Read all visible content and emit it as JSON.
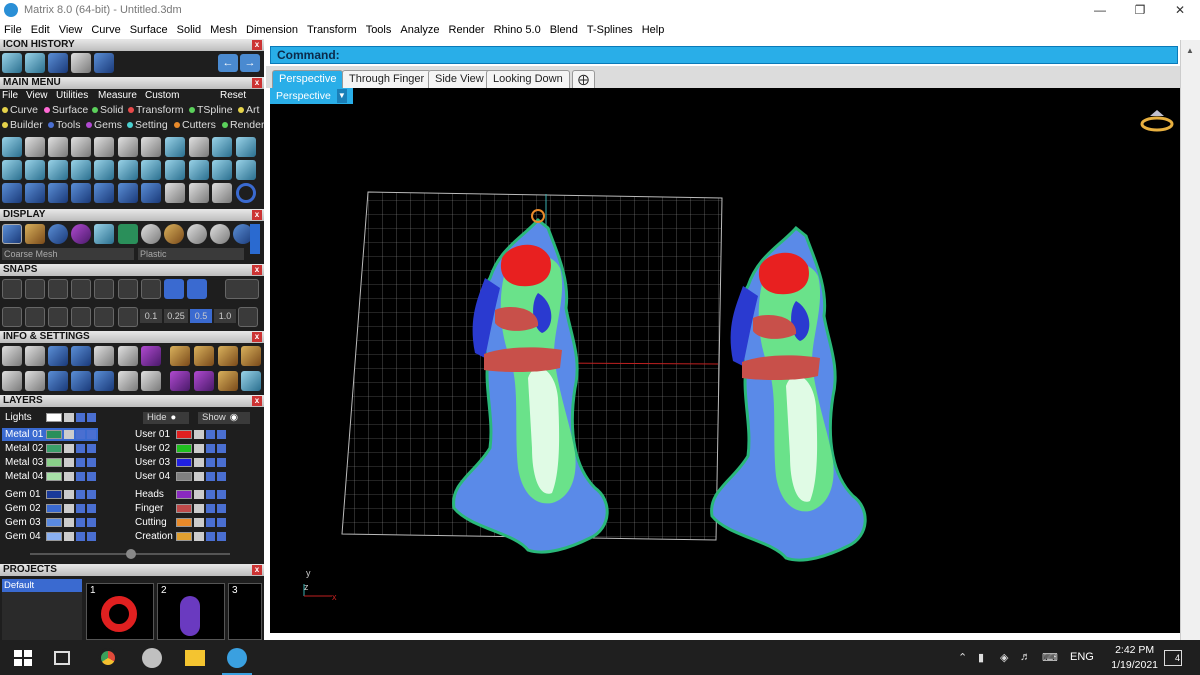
{
  "window": {
    "title": "Matrix 8.0 (64-bit) - Untitled.3dm"
  },
  "menu": [
    "File",
    "Edit",
    "View",
    "Curve",
    "Surface",
    "Solid",
    "Mesh",
    "Dimension",
    "Transform",
    "Tools",
    "Analyze",
    "Render",
    "Rhino 5.0",
    "Blend",
    "T-Splines",
    "Help"
  ],
  "panels": {
    "icon_history": "ICON HISTORY",
    "main_menu": "MAIN MENU",
    "display": "DISPLAY",
    "snaps": "SNAPS",
    "info_settings": "INFO & SETTINGS",
    "layers": "LAYERS",
    "projects": "PROJECTS"
  },
  "main_menu_bar": [
    "File",
    "View",
    "Utilities",
    "Measure",
    "Custom"
  ],
  "main_menu_reset": "Reset",
  "categories_row1": [
    {
      "label": "Curve",
      "color": "#e6d34a"
    },
    {
      "label": "Surface",
      "color": "#ff6ad5"
    },
    {
      "label": "Solid",
      "color": "#5bd05b"
    },
    {
      "label": "Transform",
      "color": "#e84a4a"
    },
    {
      "label": "TSpline",
      "color": "#5bd05b"
    },
    {
      "label": "Art",
      "color": "#e6d34a"
    }
  ],
  "categories_row2": [
    {
      "label": "Builder",
      "color": "#e6d34a"
    },
    {
      "label": "Tools",
      "color": "#4a6fd1"
    },
    {
      "label": "Gems",
      "color": "#b04ad0"
    },
    {
      "label": "Setting",
      "color": "#4ad0d0"
    },
    {
      "label": "Cutters",
      "color": "#e88a2a"
    },
    {
      "label": "Render",
      "color": "#5bd05b"
    }
  ],
  "display": {
    "mesh": "Coarse Mesh",
    "material": "Plastic"
  },
  "snaps": {
    "values": [
      "0.1",
      "0.25",
      "0.5",
      "1.0"
    ]
  },
  "layers": {
    "lights": "Lights",
    "hide": "Hide",
    "show": "Show",
    "left": [
      {
        "name": "Metal 01",
        "color": "#2a8f5a"
      },
      {
        "name": "Metal 02",
        "color": "#3aa06a"
      },
      {
        "name": "Metal 03",
        "color": "#8ad08a"
      },
      {
        "name": "Metal 04",
        "color": "#a8e0a8"
      },
      {
        "name": "Gem 01",
        "color": "#1a3a9a"
      },
      {
        "name": "Gem 02",
        "color": "#3a6ad0"
      },
      {
        "name": "Gem 03",
        "color": "#5a8ae0"
      },
      {
        "name": "Gem 04",
        "color": "#8ab0f0"
      }
    ],
    "right": [
      {
        "name": "User 01",
        "color": "#e02020"
      },
      {
        "name": "User 02",
        "color": "#20c020"
      },
      {
        "name": "User 03",
        "color": "#2020e0"
      },
      {
        "name": "User 04",
        "color": "#808080"
      },
      {
        "name": "Heads",
        "color": "#8a2ac0"
      },
      {
        "name": "Finger",
        "color": "#c04a4a"
      },
      {
        "name": "Cutting",
        "color": "#e88a2a"
      },
      {
        "name": "Creation",
        "color": "#e0a030"
      }
    ]
  },
  "projects": {
    "default": "Default",
    "thumbs": [
      "1",
      "2",
      "3"
    ]
  },
  "command": {
    "label": "Command:",
    "value": ""
  },
  "viewtabs": [
    "Perspective",
    "Through Finger",
    "Side View",
    "Looking Down"
  ],
  "viewport_label": "Perspective",
  "axis": {
    "y": "y",
    "z": "z",
    "x": "x"
  },
  "taskbar": {
    "lang": "ENG",
    "time": "2:42 PM",
    "date": "1/19/2021",
    "notif": "4"
  }
}
